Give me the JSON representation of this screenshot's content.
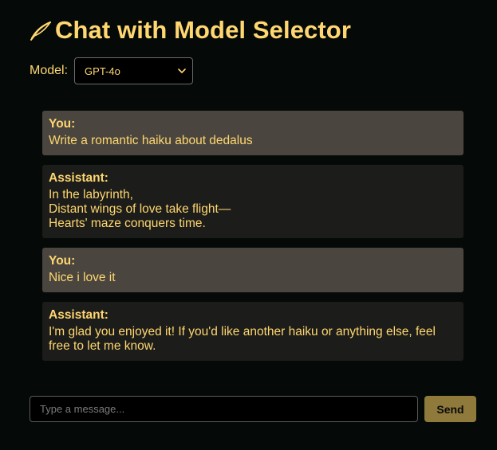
{
  "header": {
    "title": "Chat with Model Selector",
    "icon": "feather-icon"
  },
  "model_selector": {
    "label": "Model:",
    "selected": "GPT-4o"
  },
  "messages": [
    {
      "role": "You:",
      "text": "Write a romantic haiku about dedalus"
    },
    {
      "role": "Assistant:",
      "text": "In the labyrinth,\nDistant wings of love take flight—\nHearts' maze conquers time."
    },
    {
      "role": "You:",
      "text": "Nice i love it"
    },
    {
      "role": "Assistant:",
      "text": "I'm glad you enjoyed it! If you'd like another haiku or anything else, feel free to let me know."
    }
  ],
  "composer": {
    "placeholder": "Type a message...",
    "value": "",
    "send_label": "Send"
  },
  "colors": {
    "background": "#050a08",
    "accent": "#ffd770",
    "user_bubble": "#4a463f",
    "assistant_bubble": "#1c1c1a",
    "send_button": "#8f7a3c"
  }
}
